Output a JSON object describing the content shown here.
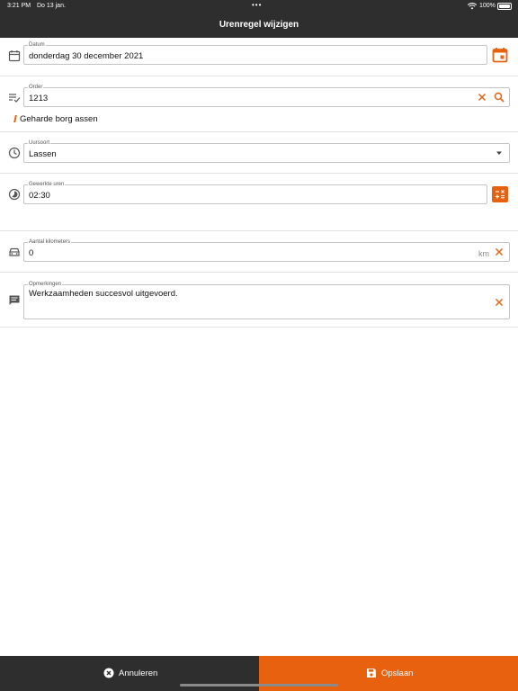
{
  "status_bar": {
    "time": "3:21 PM",
    "date": "Do 13 jan.",
    "more_dots": "•••",
    "battery_percent": "100%",
    "icons": [
      "wifi-icon",
      "battery-icon"
    ]
  },
  "header": {
    "title": "Urenregel wijzigen"
  },
  "form": {
    "datum": {
      "label": "Datum",
      "value": "donderdag 30 december 2021",
      "icon": "calendar-icon",
      "action_icon": "calendar-picker-icon"
    },
    "order": {
      "label": "Order",
      "value": "1213",
      "description": "Geharde borg assen",
      "icon": "playlist-check-icon",
      "clear_icon": "close-icon",
      "search_icon": "search-icon"
    },
    "uursoort": {
      "label": "Uursoort",
      "value": "Lassen",
      "icon": "clock-icon",
      "dropdown_icon": "caret-down-icon"
    },
    "gewerkte_uren": {
      "label": "Gewerkte uren",
      "value": "02:30",
      "icon": "timelapse-icon",
      "action_icon": "calculator-icon"
    },
    "aantal_kilometers": {
      "label": "Aantal kilometers",
      "value": "0",
      "unit": "km",
      "icon": "car-icon",
      "clear_icon": "close-icon"
    },
    "opmerkingen": {
      "label": "Opmerkingen",
      "value": "Werkzaamheden succesvol uitgevoerd.",
      "icon": "comment-icon",
      "clear_icon": "close-icon"
    }
  },
  "footer": {
    "cancel_label": "Annuleren",
    "cancel_icon": "close-circle-icon",
    "save_label": "Opslaan",
    "save_icon": "save-icon"
  },
  "colors": {
    "accent": "#e8610f",
    "header_bg": "#2e2e2e",
    "border": "#c4c4c4"
  }
}
